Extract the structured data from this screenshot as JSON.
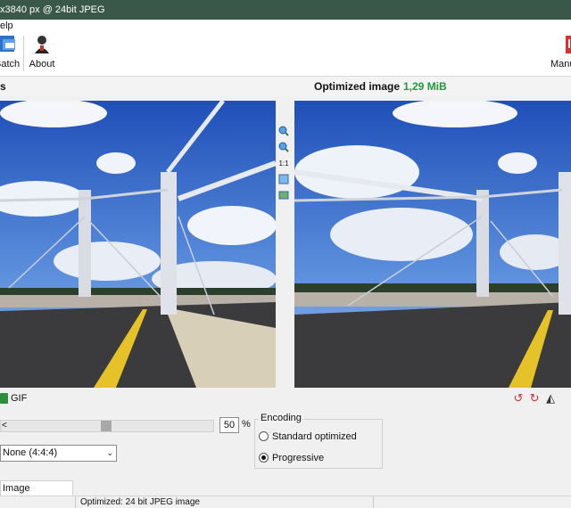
{
  "window": {
    "title": "x3840 px @ 24bit JPEG"
  },
  "menu": {
    "help": "elp"
  },
  "toolbar": {
    "batch": "Batch",
    "about": "About",
    "manual": "Manu"
  },
  "header": {
    "left_label": "s",
    "optimized_title": "Optimized image",
    "optimized_size": "1,29 MiB"
  },
  "midtools": {
    "zoom_label": "1:1"
  },
  "format": {
    "gif_label": "GIF"
  },
  "quality": {
    "value": "50",
    "unit": "%",
    "slider_fraction": 0.5,
    "left_arrow": "<"
  },
  "subsampling": {
    "selected": "None (4:4:4)"
  },
  "encoding": {
    "legend": "Encoding",
    "options": [
      "Standard optimized",
      "Progressive"
    ],
    "selected_index": 1
  },
  "tabs": {
    "image_adjustments": "Image adjustments"
  },
  "status": {
    "message": "Optimized: 24 bit JPEG image"
  },
  "colors": {
    "titlebar": "#3a5849",
    "size_green": "#1e9a3c",
    "sky": "#2f62c8"
  }
}
